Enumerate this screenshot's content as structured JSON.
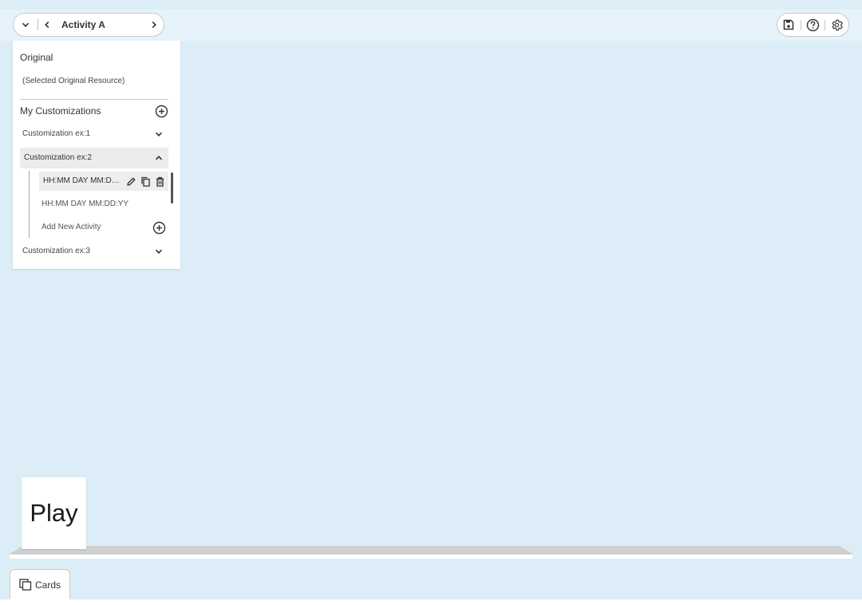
{
  "topbar": {
    "activity_title": "Activity A",
    "icons": [
      "chevron-down-icon",
      "chevron-left-icon",
      "chevron-right-icon",
      "save-icon",
      "help-icon",
      "settings-icon"
    ]
  },
  "panel": {
    "original_heading": "Original",
    "original_resource": "(Selected Original Resource)",
    "customizations_heading": "My Customizations",
    "customizations": [
      {
        "label": "Customization ex:1",
        "expanded": false
      },
      {
        "label": "Customization ex:2",
        "expanded": true
      },
      {
        "label": "Customization ex:3",
        "expanded": false
      }
    ],
    "activities": [
      {
        "label": "HH:MM DAY MM:DD:YY",
        "selected": true
      },
      {
        "label": "HH:MM DAY MM:DD:YY",
        "selected": false
      }
    ],
    "add_activity_label": "Add New Activity"
  },
  "play_card": {
    "label": "Play"
  },
  "cards_button": {
    "label": "Cards"
  },
  "colors": {
    "background": "#dcedf7",
    "topbar": "#e6f3fa",
    "panel": "#ffffff"
  }
}
